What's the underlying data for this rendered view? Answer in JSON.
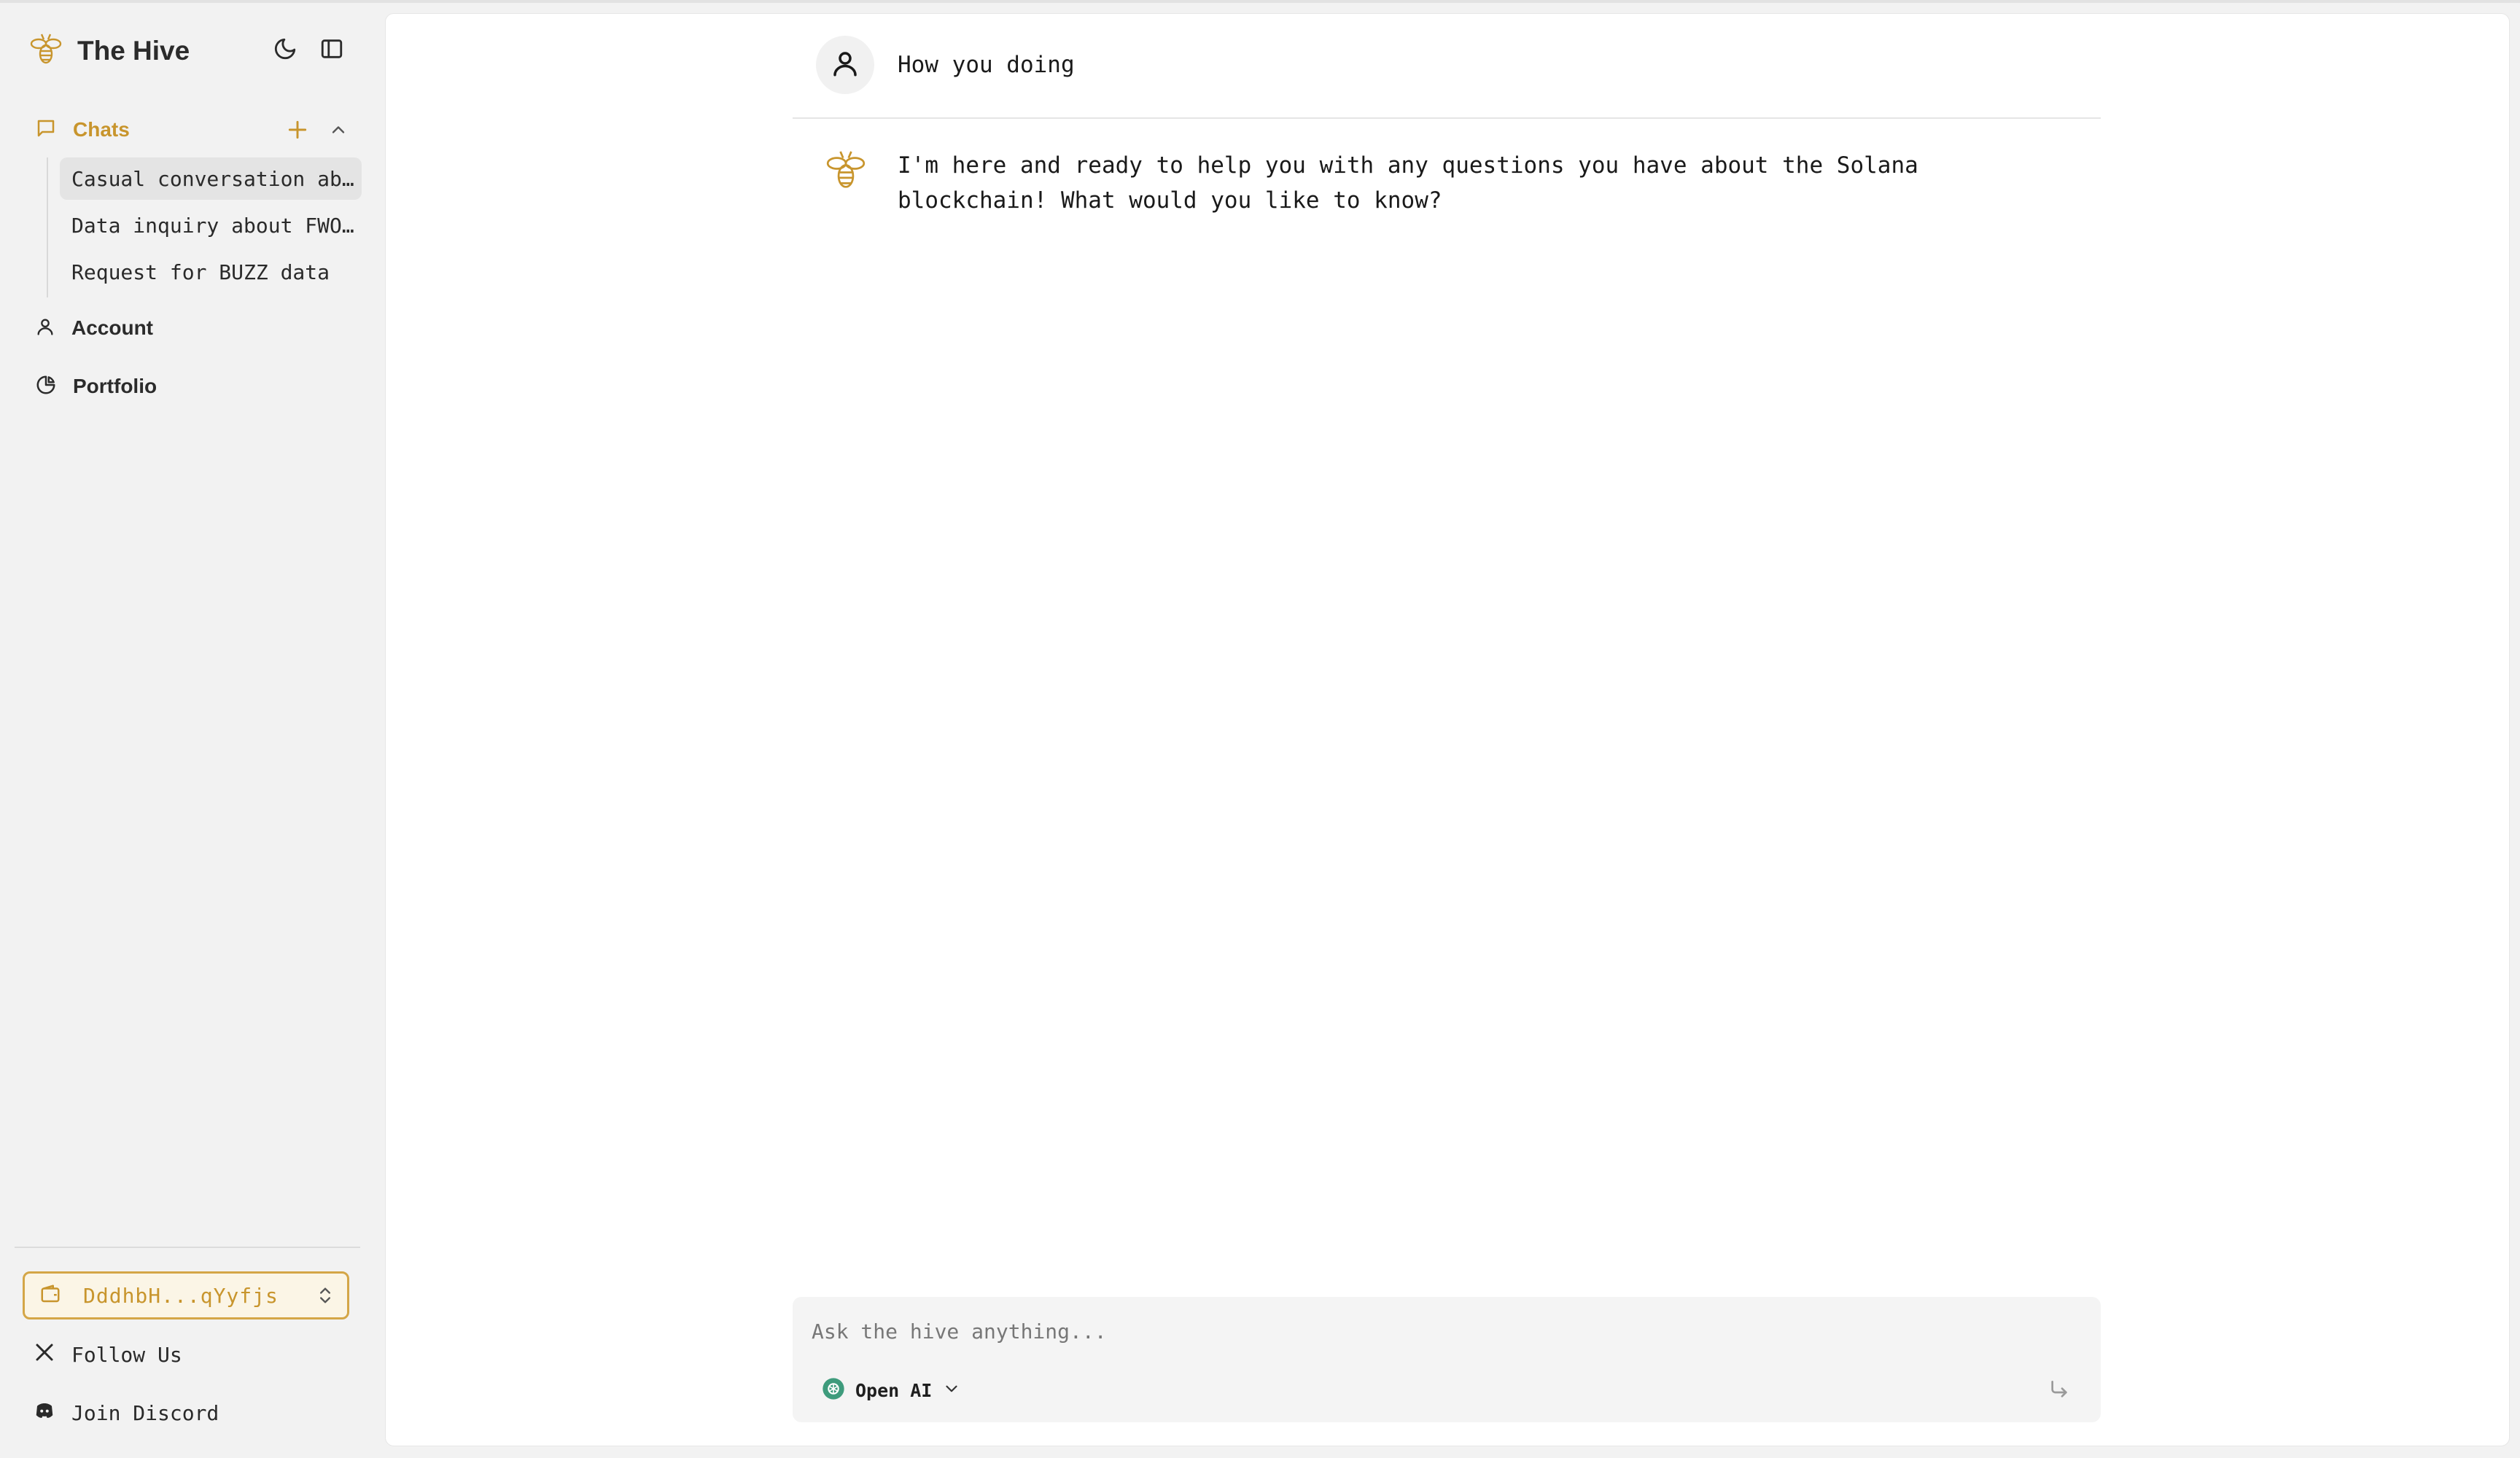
{
  "app": {
    "title": "The Hive",
    "accent_color": "#c8952d"
  },
  "sidebar": {
    "header": {
      "theme_toggle_icon": "moon-icon",
      "collapse_icon": "sidebar-panel-icon"
    },
    "chats": {
      "label": "Chats",
      "items": [
        {
          "label": "Casual conversation about Solana",
          "active": true
        },
        {
          "label": "Data inquiry about FWOG token"
        },
        {
          "label": "Request for BUZZ data"
        }
      ]
    },
    "nav": {
      "account_label": "Account",
      "portfolio_label": "Portfolio"
    },
    "wallet": {
      "address": "DddhbH...qYyfjs"
    },
    "footer": {
      "follow_label": "Follow Us",
      "discord_label": "Join Discord"
    }
  },
  "conversation": {
    "user_message": "How you doing",
    "assistant_message_line1": "I'm here and ready to help you with any questions you have about the Solana",
    "assistant_message_line2": "blockchain! What would you like to know?"
  },
  "composer": {
    "placeholder": "Ask the hive anything...",
    "model": "Open AI"
  }
}
